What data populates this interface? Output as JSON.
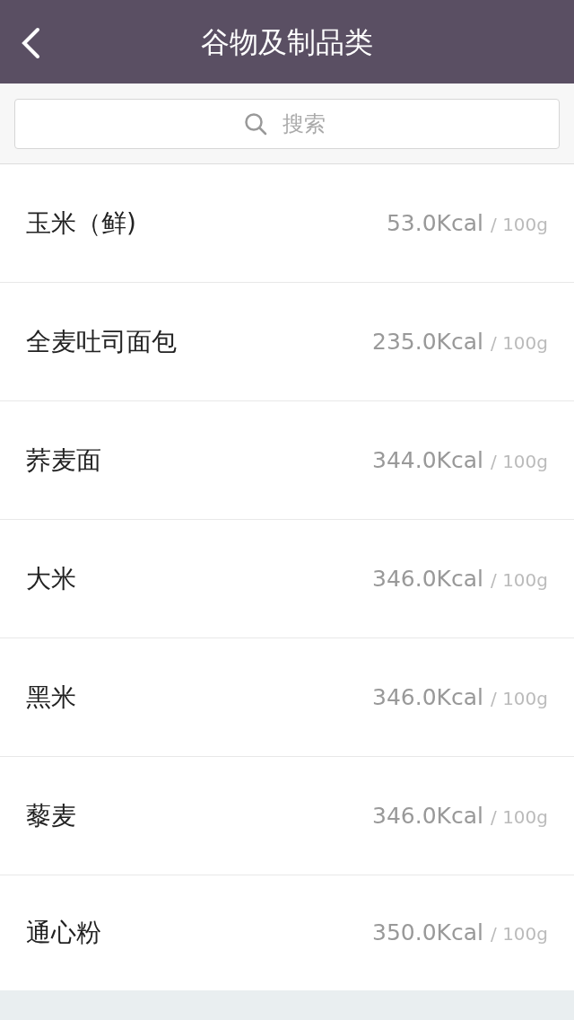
{
  "header": {
    "title": "谷物及制品类"
  },
  "search": {
    "placeholder": "搜索"
  },
  "foods": [
    {
      "name": "玉米（鲜)",
      "calories": "53.0Kcal",
      "unit": "/ 100g"
    },
    {
      "name": "全麦吐司面包",
      "calories": "235.0Kcal",
      "unit": "/ 100g"
    },
    {
      "name": "荞麦面",
      "calories": "344.0Kcal",
      "unit": "/ 100g"
    },
    {
      "name": "大米",
      "calories": "346.0Kcal",
      "unit": "/ 100g"
    },
    {
      "name": "黑米",
      "calories": "346.0Kcal",
      "unit": "/ 100g"
    },
    {
      "name": "藜麦",
      "calories": "346.0Kcal",
      "unit": "/ 100g"
    },
    {
      "name": "通心粉",
      "calories": "350.0Kcal",
      "unit": "/ 100g"
    }
  ]
}
